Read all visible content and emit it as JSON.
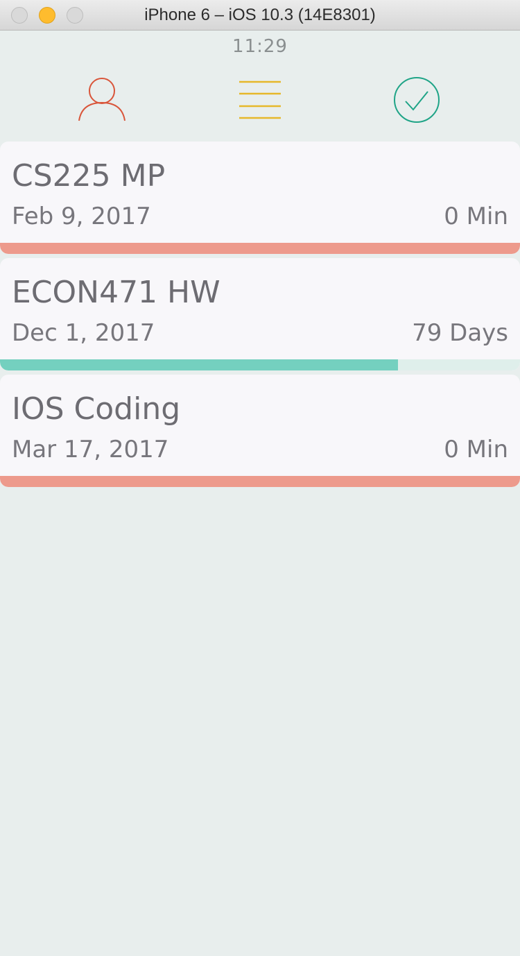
{
  "window": {
    "title": "iPhone 6 – iOS 10.3 (14E8301)"
  },
  "status_bar": {
    "time": "11:29"
  },
  "nav": {
    "icons": [
      "profile-icon",
      "menu-icon",
      "checkmark-circle-icon"
    ],
    "colors": {
      "profile": "#d9553a",
      "menu": "#e6b82a",
      "done": "#1fa487"
    }
  },
  "tasks": [
    {
      "title": "CS225 MP",
      "date": "Feb 9, 2017",
      "remaining": "0 Min",
      "progress": 1.0,
      "bar_color": "#ed9a8c"
    },
    {
      "title": "ECON471 HW",
      "date": "Dec 1, 2017",
      "remaining": "79 Days",
      "progress": 0.765,
      "bar_color": "#74d0bf"
    },
    {
      "title": "IOS Coding",
      "date": "Mar 17, 2017",
      "remaining": "0 Min",
      "progress": 1.0,
      "bar_color": "#ed9a8c"
    }
  ]
}
